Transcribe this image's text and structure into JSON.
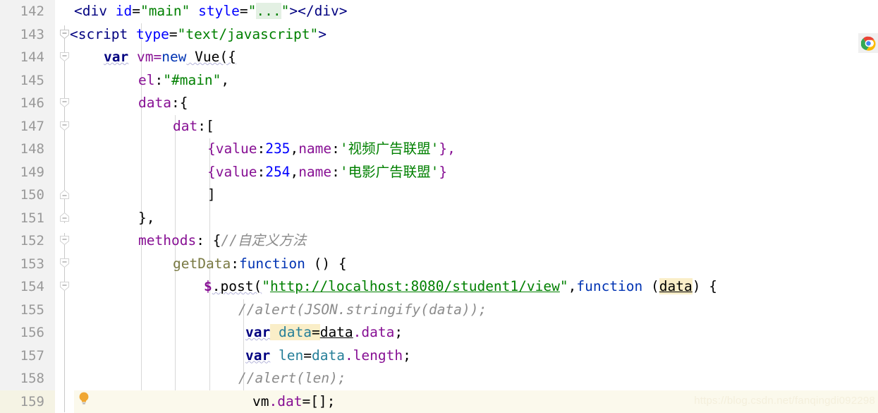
{
  "editor": {
    "watermark": "https://blog.csdn.net/fanqingdi092298",
    "current_line": 159,
    "first_line": 142,
    "last_line": 159,
    "icons": {
      "chrome": "chrome-browser-icon",
      "lightbulb": "intention-lightbulb-icon",
      "fold_open": "fold-collapse-icon",
      "fold_end": "fold-end-icon"
    },
    "colors": {
      "gutter_bg": "#f2f2f2",
      "editor_bg": "#ffffff",
      "current_line_bg": "#fbf9ec",
      "current_lineno_bg": "#f5f3e4",
      "lineno_fg": "#999999",
      "string": "#008000",
      "keyword": "#000080",
      "number": "#0000ff",
      "property": "#871094",
      "comment": "#8c8c8c",
      "function": "#7a7a43",
      "local_var": "#267f99",
      "identifier_highlight": "#faeec8",
      "folded_region": "#e3f0e3",
      "lightbulb": "#f0a732"
    }
  },
  "lines": [
    {
      "no": "142",
      "fold": "none",
      "text": "<div id=\"main\" style=\"...\"></div>"
    },
    {
      "no": "143",
      "fold": "start",
      "text": "<script type=\"text/javascript\">"
    },
    {
      "no": "144",
      "fold": "start",
      "text": "var vm=new Vue({"
    },
    {
      "no": "145",
      "fold": "none",
      "text": "el:\"#main\","
    },
    {
      "no": "146",
      "fold": "start",
      "text": "data:{"
    },
    {
      "no": "147",
      "fold": "start",
      "text": "dat:["
    },
    {
      "no": "148",
      "fold": "none",
      "text": "{value:235,name:'视频广告联盟'},"
    },
    {
      "no": "149",
      "fold": "none",
      "text": "{value:254,name:'电影广告联盟'}"
    },
    {
      "no": "150",
      "fold": "end",
      "text": "]"
    },
    {
      "no": "151",
      "fold": "end",
      "text": "},"
    },
    {
      "no": "152",
      "fold": "start",
      "text": "methods: {//自定义方法"
    },
    {
      "no": "153",
      "fold": "start",
      "text": "getData:function () {"
    },
    {
      "no": "154",
      "fold": "start",
      "text": "$.post(\"http://localhost:8080/student1/view\",function (data) {"
    },
    {
      "no": "155",
      "fold": "none",
      "text": "//alert(JSON.stringify(data));"
    },
    {
      "no": "156",
      "fold": "none",
      "text": "var data=data.data;"
    },
    {
      "no": "157",
      "fold": "none",
      "text": "var len=data.length;"
    },
    {
      "no": "158",
      "fold": "none",
      "text": "//alert(len);"
    },
    {
      "no": "159",
      "fold": "none",
      "text": "vm.dat=[];"
    }
  ],
  "tokens": {
    "l142": {
      "a": "<div",
      "b": " ",
      "c": "id",
      "d": "=",
      "e": "\"main\"",
      "f": " ",
      "g": "style",
      "h": "=",
      "i": "\"",
      "j": "...",
      "k": "\"",
      "l": "></div>"
    },
    "l143": {
      "a": "<script",
      "b": " ",
      "c": "type",
      "d": "=",
      "e": "\"text/javascript\"",
      "f": ">"
    },
    "l144": {
      "a": "var",
      "b": " vm=",
      "c": "new",
      "d": " Vue({"
    },
    "l145": {
      "a": "el",
      "b": ":",
      "c": "\"#main\"",
      "d": ","
    },
    "l146": {
      "a": "data",
      "b": ":{"
    },
    "l147": {
      "a": "dat",
      "b": ":["
    },
    "l148": {
      "a": "{",
      "b": "value",
      "c": ":",
      "d": "235",
      "e": ",",
      "f": "name",
      "g": ":",
      "h": "'视频广告联盟'",
      "i": "},"
    },
    "l149": {
      "a": "{",
      "b": "value",
      "c": ":",
      "d": "254",
      "e": ",",
      "f": "name",
      "g": ":",
      "h": "'电影广告联盟'",
      "i": "}"
    },
    "l150": {
      "a": "]"
    },
    "l151": {
      "a": "},"
    },
    "l152": {
      "a": "methods",
      "b": ": {",
      "c": "//自定义方法"
    },
    "l153": {
      "a": "getData",
      "b": ":",
      "c": "function",
      "d": " () {"
    },
    "l154": {
      "a": "$",
      "b": ".post(",
      "c": "\"",
      "d": "http://localhost:8080/student1/view",
      "e": "\"",
      "f": ",",
      "g": "function",
      "h": " (",
      "i": "data",
      "j": ") {"
    },
    "l155": {
      "a": "//alert(JSON.stringify(data));"
    },
    "l156": {
      "a": "var",
      "b": " ",
      "c": "data",
      "d": "=",
      "e": "data",
      "f": ".data",
      "g": ";"
    },
    "l157": {
      "a": "var",
      "b": " ",
      "c": "len",
      "d": "=",
      "e": "data",
      "f": ".length",
      "g": ";"
    },
    "l158": {
      "a": "//alert(len);"
    },
    "l159": {
      "a": "vm",
      "b": ".dat",
      "c": "=[];"
    }
  }
}
